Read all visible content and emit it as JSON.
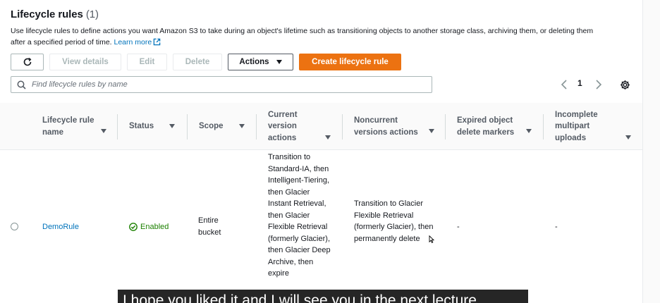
{
  "header": {
    "title": "Lifecycle rules",
    "count": "(1)",
    "description": "Use lifecycle rules to define actions you want Amazon S3 to take during an object's lifetime such as transitioning objects to another storage class, archiving them, or deleting them after a specified period of time.",
    "learn_more": "Learn more"
  },
  "toolbar": {
    "view_details": "View details",
    "edit": "Edit",
    "delete": "Delete",
    "actions": "Actions",
    "create": "Create lifecycle rule"
  },
  "search": {
    "placeholder": "Find lifecycle rules by name"
  },
  "pagination": {
    "page": "1"
  },
  "table": {
    "columns": [
      "Lifecycle rule name",
      "Status",
      "Scope",
      "Current version actions",
      "Noncurrent versions actions",
      "Expired object delete markers",
      "Incomplete multipart uploads"
    ],
    "rows": [
      {
        "name": "DemoRule",
        "status": "Enabled",
        "scope": "Entire bucket",
        "current_actions": "Transition to Standard-IA, then Intelligent-Tiering, then Glacier Instant Retrieval, then Glacier Flexible Retrieval (formerly Glacier), then Glacier Deep Archive, then expire",
        "noncurrent_actions": "Transition to Glacier Flexible Retrieval (formerly Glacier), then permanently delete",
        "expired_markers": "-",
        "incomplete_uploads": "-"
      }
    ]
  },
  "subtitle": "I hope you liked it and I will see you in the next lecture.",
  "colors": {
    "primary": "#ec7211",
    "link": "#0073bb",
    "success": "#1d8102"
  },
  "icons": [
    "refresh-icon",
    "caret-down-icon",
    "search-icon",
    "chevron-left-icon",
    "chevron-right-icon",
    "gear-icon",
    "external-link-icon",
    "success-check-icon"
  ]
}
